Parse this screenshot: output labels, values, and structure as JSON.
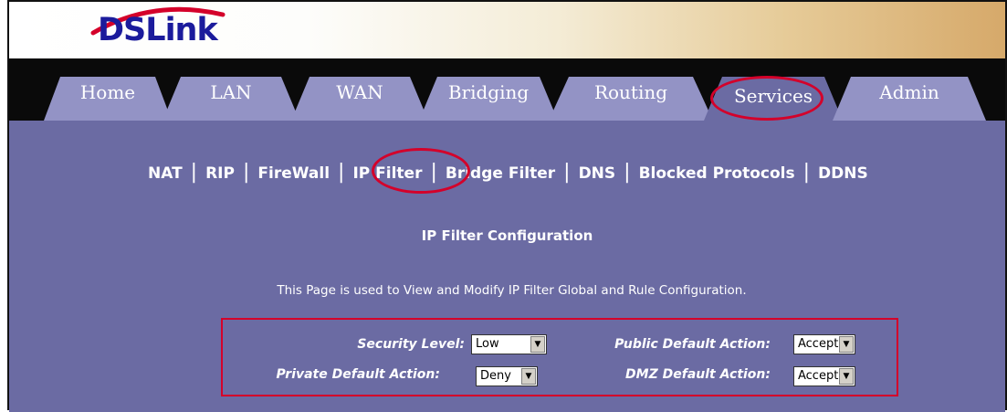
{
  "brand": {
    "logo_text": "DSLink"
  },
  "tabs": [
    {
      "label": "Home"
    },
    {
      "label": "LAN"
    },
    {
      "label": "WAN"
    },
    {
      "label": "Bridging"
    },
    {
      "label": "Routing"
    },
    {
      "label": "Services",
      "active": true
    },
    {
      "label": "Admin"
    }
  ],
  "subnav": [
    {
      "label": "NAT"
    },
    {
      "label": "RIP"
    },
    {
      "label": "FireWall"
    },
    {
      "label": "IP Filter",
      "active": true
    },
    {
      "label": "Bridge Filter"
    },
    {
      "label": "DNS"
    },
    {
      "label": "Blocked Protocols"
    },
    {
      "label": "DDNS"
    }
  ],
  "page": {
    "title": "IP Filter Configuration",
    "description": "This Page is used to View and Modify IP Filter Global and Rule Configuration."
  },
  "config": {
    "security_level": {
      "label": "Security Level:",
      "value": "Low"
    },
    "private_default_action": {
      "label": "Private Default Action:",
      "value": "Deny"
    },
    "public_default_action": {
      "label": "Public Default Action:",
      "value": "Accept"
    },
    "dmz_default_action": {
      "label": "DMZ Default Action:",
      "value": "Accept"
    }
  },
  "colors": {
    "content_bg": "#6b6ba3",
    "tab_bg": "#9393c5",
    "tab_active_bg": "#6b6ba3",
    "highlight": "#d4002a",
    "logo": "#1b1b9c"
  },
  "icons": {
    "select_arrow": "chevron-down-icon"
  }
}
